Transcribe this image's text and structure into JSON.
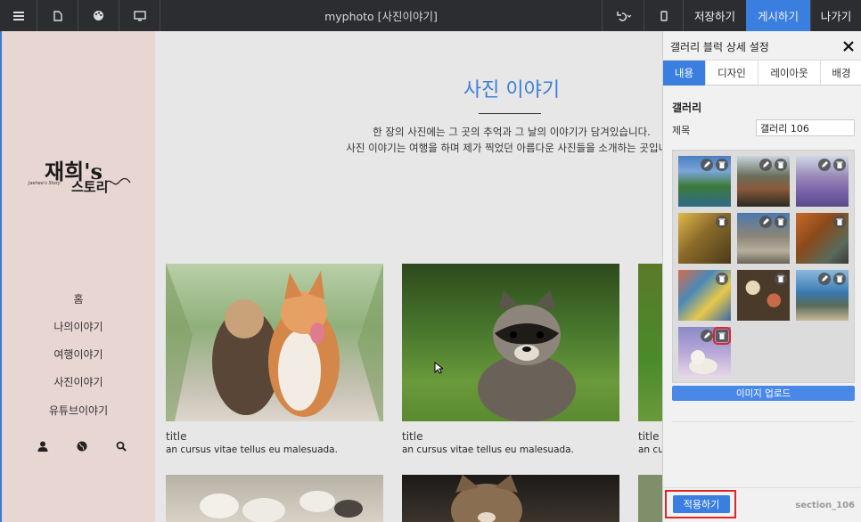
{
  "topbar": {
    "icons": [
      "menu-icon",
      "page-icon",
      "palette-icon",
      "monitor-icon",
      "undo-icon",
      "mobile-icon"
    ],
    "title": "myphoto [사진이야기]",
    "save_label": "저장하기",
    "publish_label": "게시하기",
    "exit_label": "나가기",
    "accent": "#3a7fe0"
  },
  "sidebar": {
    "logo_main": "재희's",
    "logo_sub": "스토리",
    "logo_small": "Jaehee's Story",
    "items": [
      {
        "label": "홈"
      },
      {
        "label": "나의이야기"
      },
      {
        "label": "여행이야기"
      },
      {
        "label": "사진이야기"
      },
      {
        "label": "유튜브이야기"
      }
    ],
    "icons": [
      "user-icon",
      "globe-icon",
      "search-icon"
    ],
    "background": "#e8d6d3"
  },
  "main": {
    "title": "사진 이야기",
    "intro_line1": "한 장의 사진에는 그 곳의 추억과 그 날의 이야기가 담겨있습니다.",
    "intro_line2": "사진 이야기는 여행을 하며 제가 찍었던 아름다운 사진들을 소개하는 곳입니다",
    "cards": [
      {
        "title": "title",
        "desc": "an cursus vitae tellus eu malesuada."
      },
      {
        "title": "title",
        "desc": "an cursus vitae tellus eu malesuada."
      },
      {
        "title": "title",
        "desc": "an cursus vitae tellus eu malesuada."
      }
    ]
  },
  "panel": {
    "header": "갤러리 블럭 상세 설정",
    "tabs": [
      "내용",
      "디자인",
      "레이아웃",
      "배경"
    ],
    "active_tab": "내용",
    "section_label": "갤러리",
    "title_label": "제목",
    "title_value": "갤러리 106",
    "upload_label": "이미지 업로드",
    "apply_label": "적용하기",
    "section_id": "section_106"
  }
}
